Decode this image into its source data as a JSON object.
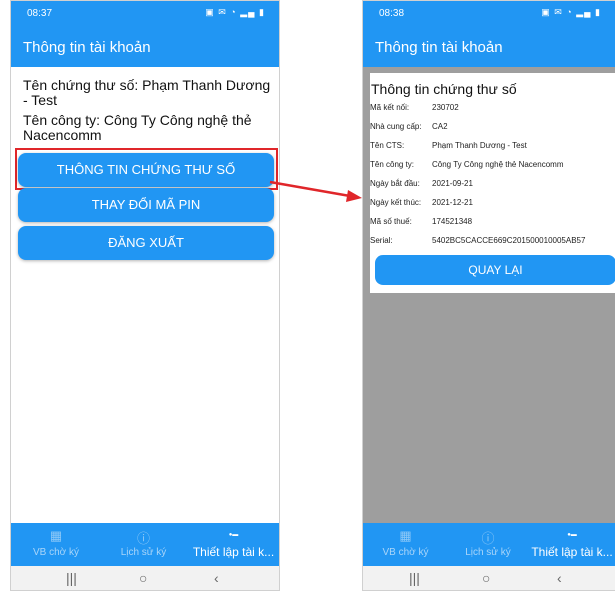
{
  "left_screen": {
    "status_time": "08:37",
    "status_icons": "▣ ✉ ◔ ▂▄ ▮",
    "title": "Thông tin tài khoản",
    "cert_name": "Tên chứng thư số: Phạm Thanh Dương - Test",
    "company": "Tên công ty: Công Ty Công nghệ thẻ Nacencomm",
    "buttons": {
      "cert_info": "THÔNG TIN CHỨNG THƯ SỐ",
      "change_pin": "THAY ĐỔI MÃ PIN",
      "logout": "ĐĂNG XUẤT"
    }
  },
  "right_screen": {
    "status_time": "08:38",
    "status_icons": "▣ ✉ ◔ ▂▄ ▮",
    "title": "Thông tin tài khoản",
    "dialog": {
      "title": "Thông tin chứng thư số",
      "fields": [
        {
          "label": "Mã kết nối:",
          "value": "230702"
        },
        {
          "label": "Nhà cung cấp:",
          "value": "CA2"
        },
        {
          "label": "Tên CTS:",
          "value": "Phạm Thanh Dương - Test"
        },
        {
          "label": "Tên công ty:",
          "value": "Công Ty Công nghệ thẻ Nacencomm"
        },
        {
          "label": "Ngày bắt đầu:",
          "value": "2021-09-21"
        },
        {
          "label": "Ngày kết thúc:",
          "value": "2021-12-21"
        },
        {
          "label": "Mã số thuế:",
          "value": "174521348"
        },
        {
          "label": "Serial:",
          "value": "5402BC5CACCE669C201500010005AB57"
        }
      ],
      "back_button": "QUAY LẠI"
    }
  },
  "bottom_nav": {
    "items": [
      {
        "label": "VB chờ ký",
        "icon": "document-grid-icon"
      },
      {
        "label": "Lịch sử ký",
        "icon": "history-info-icon"
      },
      {
        "label": "Thiết lập tài k...",
        "icon": "settings-dot-icon"
      }
    ]
  },
  "system_nav": {
    "recent": "|||",
    "home": "○",
    "back": "‹"
  },
  "colors": {
    "primary": "#2196f3",
    "highlight": "#e0262a",
    "overlay": "#9e9e9e"
  }
}
